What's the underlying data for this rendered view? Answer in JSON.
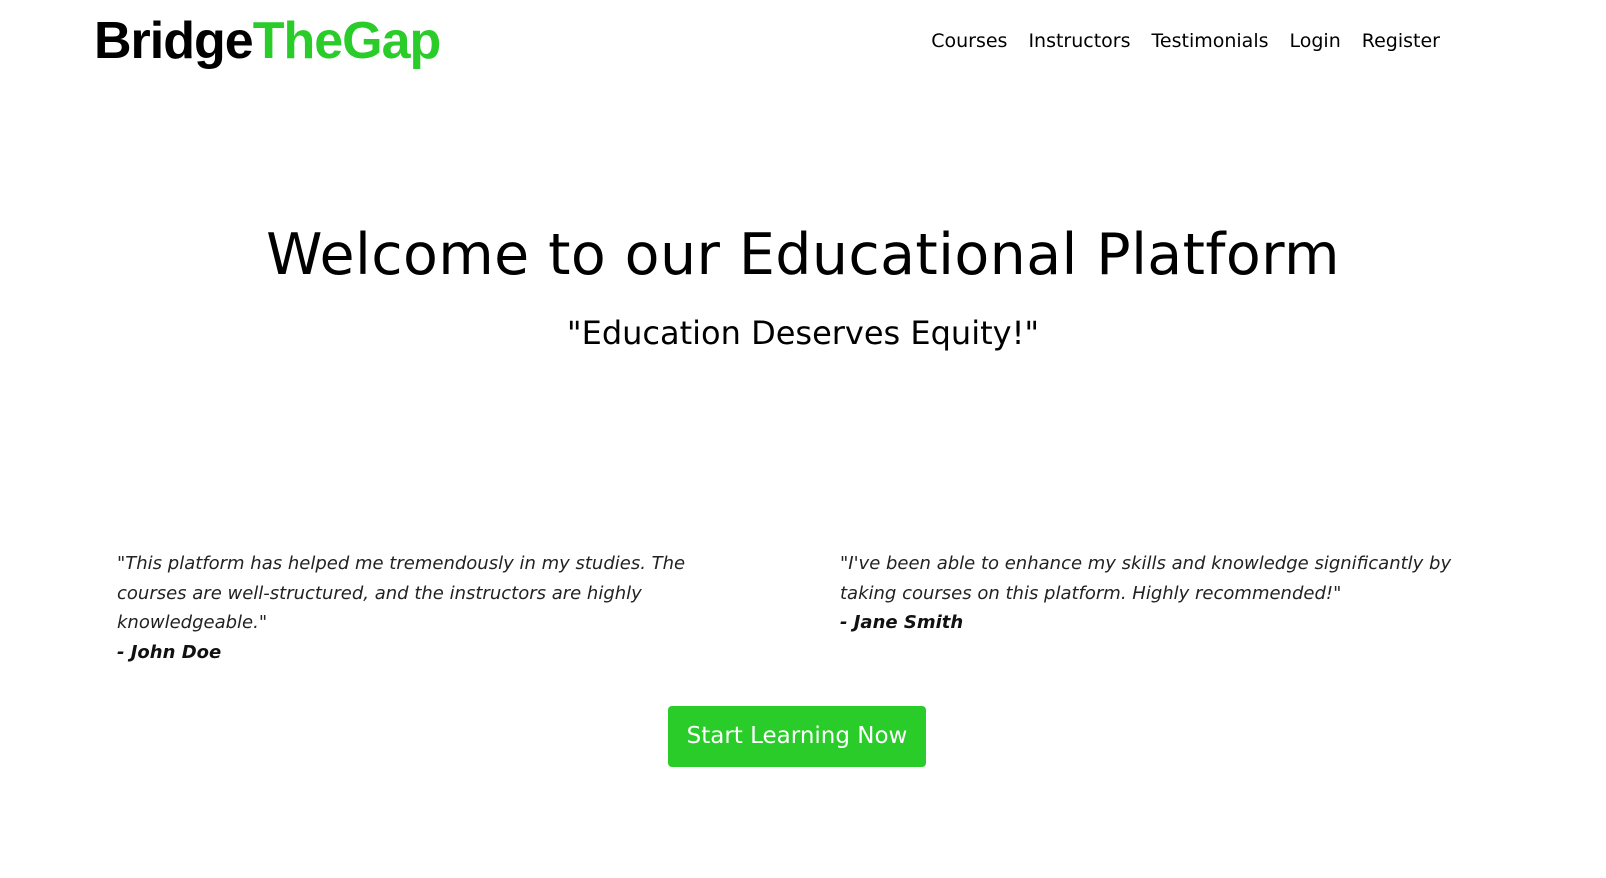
{
  "brand": {
    "part1": "Bridge",
    "part2": "TheGap",
    "accent_color": "#29cc29"
  },
  "nav": {
    "items": [
      {
        "label": "Courses"
      },
      {
        "label": "Instructors"
      },
      {
        "label": "Testimonials"
      },
      {
        "label": "Login"
      },
      {
        "label": "Register"
      }
    ]
  },
  "hero": {
    "title": "Welcome to our Educational Platform",
    "subtitle": "\"Education Deserves Equity!\""
  },
  "testimonials": [
    {
      "quote": "\"This platform has helped me tremendously in my studies. The courses are well-structured, and the instructors are highly knowledgeable.\"",
      "author": "- John Doe"
    },
    {
      "quote": "\"I've been able to enhance my skills and knowledge significantly by taking courses on this platform. Highly recommended!\"",
      "author": "- Jane Smith"
    }
  ],
  "cta": {
    "label": "Start Learning Now"
  }
}
